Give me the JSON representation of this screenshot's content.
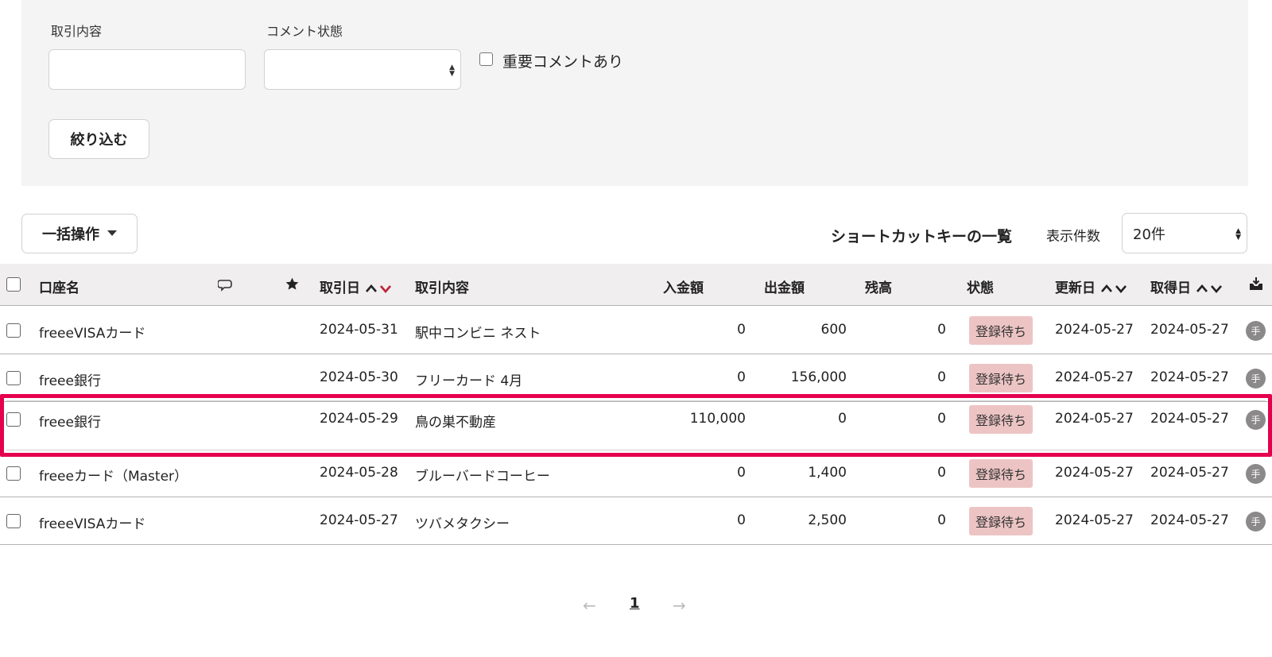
{
  "filters": {
    "description_label": "取引内容",
    "description_value": "",
    "comment_status_label": "コメント状態",
    "comment_status_value": "",
    "important_comment_label": "重要コメントあり",
    "filter_button": "絞り込む"
  },
  "toolbar": {
    "bulk_action": "一括操作",
    "shortcut_list": "ショートカットキーの一覧",
    "per_page_label": "表示件数",
    "per_page_value": "20件"
  },
  "table": {
    "headers": {
      "account": "口座名",
      "date": "取引日",
      "description": "取引内容",
      "deposit": "入金額",
      "withdrawal": "出金額",
      "balance": "残高",
      "status": "状態",
      "updated": "更新日",
      "acquired": "取得日"
    },
    "rows": [
      {
        "account": "freeeVISAカード",
        "date": "2024-05-31",
        "description": "駅中コンビニ ネスト",
        "deposit": "0",
        "withdrawal": "600",
        "balance": "0",
        "status": "登録待ち",
        "updated": "2024-05-27",
        "acquired": "2024-05-27",
        "source": "手"
      },
      {
        "account": "freee銀行",
        "date": "2024-05-30",
        "description": "フリーカード 4月",
        "deposit": "0",
        "withdrawal": "156,000",
        "balance": "0",
        "status": "登録待ち",
        "updated": "2024-05-27",
        "acquired": "2024-05-27",
        "source": "手"
      },
      {
        "account": "freee銀行",
        "date": "2024-05-29",
        "description": "鳥の巣不動産",
        "deposit": "110,000",
        "withdrawal": "0",
        "balance": "0",
        "status": "登録待ち",
        "updated": "2024-05-27",
        "acquired": "2024-05-27",
        "source": "手"
      },
      {
        "account": "freeeカード（Master）",
        "date": "2024-05-28",
        "description": "ブルーバードコーヒー",
        "deposit": "0",
        "withdrawal": "1,400",
        "balance": "0",
        "status": "登録待ち",
        "updated": "2024-05-27",
        "acquired": "2024-05-27",
        "source": "手"
      },
      {
        "account": "freeeVISAカード",
        "date": "2024-05-27",
        "description": "ツバメタクシー",
        "deposit": "0",
        "withdrawal": "2,500",
        "balance": "0",
        "status": "登録待ち",
        "updated": "2024-05-27",
        "acquired": "2024-05-27",
        "source": "手"
      }
    ],
    "highlighted_row": 2
  },
  "pagination": {
    "prev": "←",
    "current": "1",
    "next": "→"
  },
  "colors": {
    "highlight": "#e5004f",
    "sort_active": "#c0203a",
    "badge_bg": "#edc4c4",
    "panel_bg": "#f5f4f4"
  },
  "icons": [
    "comment-icon",
    "star-icon",
    "sort-arrows-icon",
    "inbox-icon",
    "manual-entry-icon",
    "caret-down-icon"
  ]
}
